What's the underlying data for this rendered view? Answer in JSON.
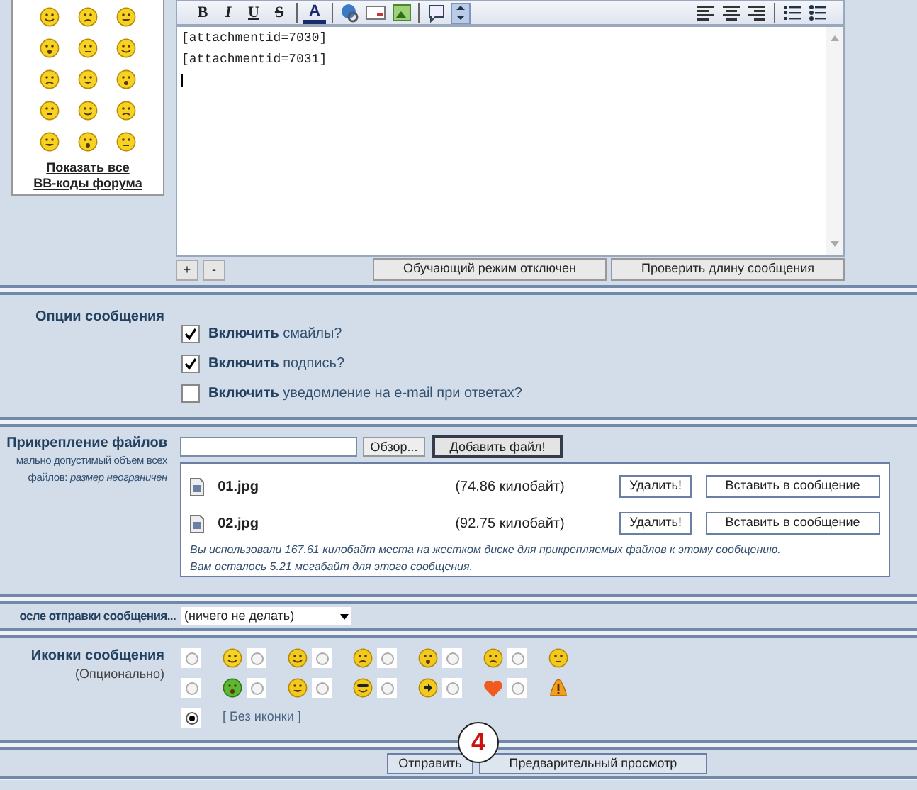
{
  "smilies_box": {
    "link_lines": [
      "Показать все",
      "BB-коды форума"
    ]
  },
  "editor": {
    "format_buttons": [
      "B",
      "I",
      "U",
      "S"
    ],
    "color_button": "A",
    "lines": [
      "[attachmentid=7030]",
      "[attachmentid=7031]"
    ],
    "size_buttons": [
      "+",
      "-"
    ],
    "buttons": [
      "Обучающий режим отключен",
      "Проверить длину сообщения"
    ]
  },
  "options": {
    "title": "Опции сообщения",
    "checkboxes": [
      {
        "text": "**Включить** смайлы?",
        "checked": true
      },
      {
        "text": "**Включить** подпись?",
        "checked": true
      },
      {
        "text": "**Включить** уведомление на e-mail при ответах?",
        "checked": false
      }
    ]
  },
  "attachments": {
    "title": "Прикрепление файлов",
    "notes": [
      "мально допустимый объем всех",
      "файлов: *размер неограничен*"
    ],
    "browse_button": "Обзор...",
    "add_button": "Добавить файл!",
    "files": [
      {
        "name": "01.jpg",
        "size": "(74.86 килобайт)",
        "delete": "Удалить!",
        "insert": "Вставить в сообщение"
      },
      {
        "name": "02.jpg",
        "size": "(92.75 килобайт)",
        "delete": "Удалить!",
        "insert": "Вставить в сообщение"
      }
    ],
    "usage": [
      "Вы использовали 167.61 килобайт места на жестком диске для прикрепляемых файлов к этому сообщению.",
      "Вам осталось 5.21 мегабайт для этого сообщения."
    ]
  },
  "after_post": {
    "label": "осле отправки сообщения...",
    "value": "(ничего не делать)"
  },
  "post_icons": {
    "title": "Иконки сообщения",
    "subtitle": "(Опционально)",
    "icons": [
      {
        "selected": false
      },
      {
        "selected": false
      },
      {
        "selected": false
      },
      {
        "selected": false
      },
      {
        "selected": false
      },
      {
        "selected": false
      },
      {
        "selected": false
      },
      {
        "selected": false
      },
      {
        "selected": false
      },
      {
        "selected": false
      },
      {
        "selected": false
      },
      {
        "selected": false
      }
    ],
    "none_option": {
      "label": "[ Без иконки ]",
      "selected": true
    }
  },
  "buttons": [
    "Отправить",
    "Предварительный просмотр"
  ],
  "annotation": "4"
}
